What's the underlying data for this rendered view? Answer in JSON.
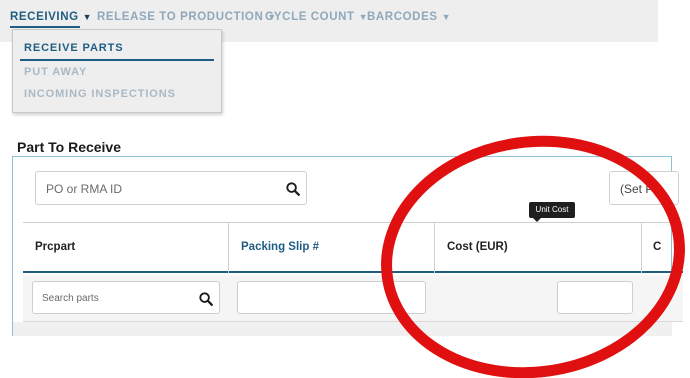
{
  "nav": {
    "items": [
      {
        "label": "RECEIVING",
        "active": true
      },
      {
        "label": "RELEASE TO PRODUCTION",
        "active": false
      },
      {
        "label": "CYCLE COUNT",
        "active": false
      },
      {
        "label": "BARCODES",
        "active": false
      }
    ],
    "caret": "▼"
  },
  "dropdown": {
    "items": [
      {
        "label": "RECEIVE PARTS",
        "active": true
      },
      {
        "label": "PUT AWAY",
        "active": false
      },
      {
        "label": "INCOMING INSPECTIONS",
        "active": false
      }
    ]
  },
  "section": {
    "title": "Part To Receive"
  },
  "filters": {
    "po_placeholder": "PO or RMA ID",
    "set_value": "(Set P"
  },
  "tooltip": {
    "text": "Unit Cost"
  },
  "table": {
    "headers": [
      "Prcpart",
      "Packing Slip #",
      "Cost (EUR)",
      "C"
    ],
    "search_placeholder": "Search parts"
  },
  "colors": {
    "accent": "#1f5d82",
    "nav_inactive": "#8fa8bb",
    "panel_border": "#8ec0d8",
    "annotation_red": "#e01010"
  },
  "icons": {
    "search": "search-icon",
    "caret": "caret-down-icon"
  }
}
